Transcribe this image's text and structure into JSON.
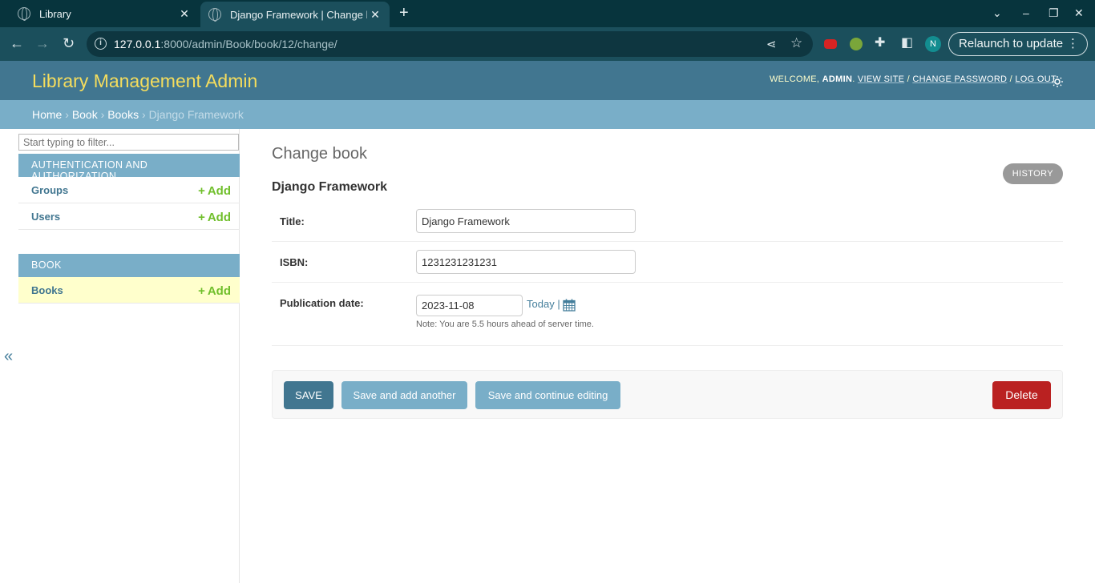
{
  "browser": {
    "tabs": [
      {
        "title": "Library"
      },
      {
        "title": "Django Framework | Change book | Library Management Admin"
      }
    ],
    "url_host": "127.0.0.1",
    "url_rest": ":8000/admin/Book/book/12/change/",
    "relaunch_label": "Relaunch to update",
    "profile_initial": "N"
  },
  "header": {
    "brand": "Library Management Admin",
    "welcome": "WELCOME,",
    "username": "ADMIN",
    "view_site": "VIEW SITE",
    "change_password": "CHANGE PASSWORD",
    "log_out": "LOG OUT"
  },
  "breadcrumbs": {
    "home": "Home",
    "app": "Book",
    "model": "Books",
    "current": "Django Framework"
  },
  "sidebar": {
    "filter_placeholder": "Start typing to filter...",
    "apps": [
      {
        "caption": "AUTHENTICATION AND AUTHORIZATION",
        "models": [
          {
            "name": "Groups",
            "add": "Add"
          },
          {
            "name": "Users",
            "add": "Add"
          }
        ]
      },
      {
        "caption": "BOOK",
        "models": [
          {
            "name": "Books",
            "add": "Add"
          }
        ]
      }
    ],
    "collapse_glyph": "«"
  },
  "main": {
    "page_title": "Change book",
    "history_label": "HISTORY",
    "object_title": "Django Framework",
    "fields": {
      "title": {
        "label": "Title:",
        "value": "Django Framework"
      },
      "isbn": {
        "label": "ISBN:",
        "value": "1231231231231"
      },
      "pubdate": {
        "label": "Publication date:",
        "value": "2023-11-08",
        "today": "Today",
        "help": "Note: You are 5.5 hours ahead of server time."
      }
    },
    "buttons": {
      "save": "SAVE",
      "save_add": "Save and add another",
      "save_continue": "Save and continue editing",
      "delete": "Delete"
    }
  }
}
